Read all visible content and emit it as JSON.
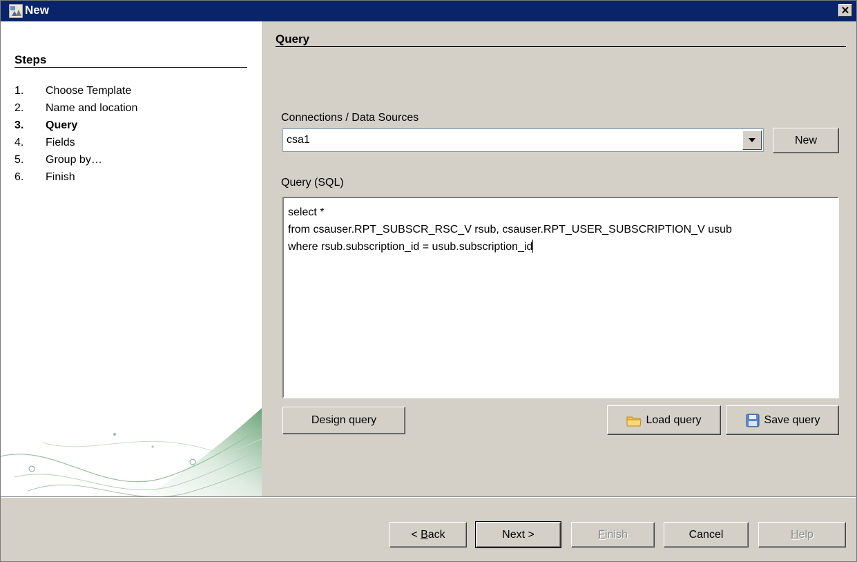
{
  "window": {
    "title": "New",
    "close_label": "✕"
  },
  "sidebar": {
    "title": "Steps",
    "steps": [
      {
        "num": "1.",
        "label": "Choose Template",
        "active": false
      },
      {
        "num": "2.",
        "label": "Name and location",
        "active": false
      },
      {
        "num": "3.",
        "label": "Query",
        "active": true
      },
      {
        "num": "4.",
        "label": "Fields",
        "active": false
      },
      {
        "num": "5.",
        "label": "Group by…",
        "active": false
      },
      {
        "num": "6.",
        "label": "Finish",
        "active": false
      }
    ]
  },
  "main": {
    "title": "Query",
    "connections_label": "Connections / Data Sources",
    "connection_value": "csa1",
    "new_button": "New",
    "query_label": "Query (SQL)",
    "query_text": "select *\nfrom csauser.RPT_SUBSCR_RSC_V rsub, csauser.RPT_USER_SUBSCRIPTION_V usub\nwhere rsub.subscription_id = usub.subscription_id",
    "design_query_button": "Design query",
    "load_query_button": "Load query",
    "save_query_button": "Save query"
  },
  "footer": {
    "back_prefix": "< ",
    "back_mnemonic": "B",
    "back_rest": "ack",
    "next_button": "Next >",
    "finish_mnemonic": "F",
    "finish_rest": "inish",
    "cancel_button": "Cancel",
    "help_mnemonic": "H",
    "help_rest": "elp"
  },
  "colors": {
    "titlebar": "#0a246a",
    "dialog_bg": "#d4d0c8",
    "accent_green": "#5b9a6a"
  }
}
